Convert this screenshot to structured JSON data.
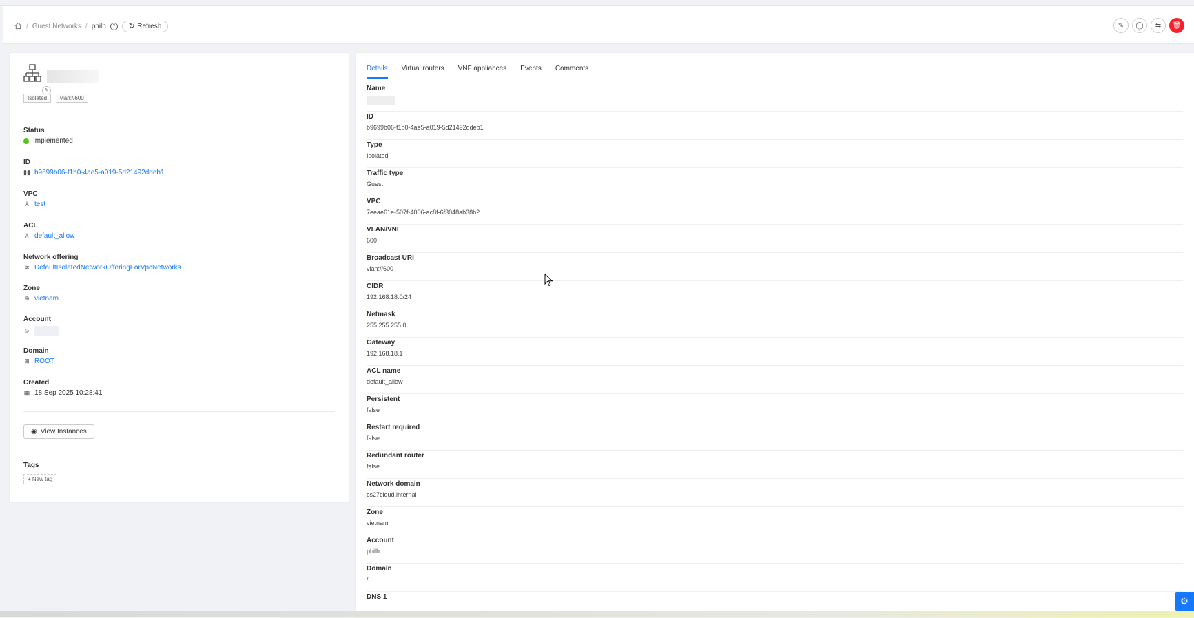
{
  "breadcrumb": {
    "section": "Guest Networks",
    "current": "philh",
    "refresh": "Refresh"
  },
  "header_actions": [
    {
      "icon": "edit-icon",
      "glyph": "✎"
    },
    {
      "icon": "restart-icon",
      "glyph": "◯"
    },
    {
      "icon": "swap-icon",
      "glyph": "⇆"
    },
    {
      "icon": "delete-icon",
      "glyph": "🗑"
    }
  ],
  "left": {
    "tags": [
      "Isolated",
      "vlan://600"
    ],
    "status": {
      "label": "Status",
      "value": "Implemented",
      "color": "#52c41a"
    },
    "id": {
      "label": "ID",
      "value": "b9699b06-f1b0-4ae5-a019-5d21492ddeb1"
    },
    "vpc": {
      "label": "VPC",
      "value": "test"
    },
    "acl": {
      "label": "ACL",
      "value": "default_allow"
    },
    "offering": {
      "label": "Network offering",
      "value": "DefaultIsolatedNetworkOfferingForVpcNetworks"
    },
    "zone": {
      "label": "Zone",
      "value": "vietnam"
    },
    "account": {
      "label": "Account"
    },
    "domain": {
      "label": "Domain",
      "value": "ROOT"
    },
    "created": {
      "label": "Created",
      "value": "18 Sep 2025 10:28:41"
    },
    "view_instances": "View Instances",
    "tags_label": "Tags",
    "new_tag": "+ New tag"
  },
  "tabs": [
    "Details",
    "Virtual routers",
    "VNF appliances",
    "Events",
    "Comments"
  ],
  "details": [
    {
      "k": "Name",
      "v": ""
    },
    {
      "k": "ID",
      "v": "b9699b06-f1b0-4ae5-a019-5d21492ddeb1"
    },
    {
      "k": "Type",
      "v": "Isolated"
    },
    {
      "k": "Traffic type",
      "v": "Guest"
    },
    {
      "k": "VPC",
      "v": "7eeae61e-507f-4006-ac8f-6f3048ab38b2"
    },
    {
      "k": "VLAN/VNI",
      "v": "600"
    },
    {
      "k": "Broadcast URI",
      "v": "vlan://600"
    },
    {
      "k": "CIDR",
      "v": "192.168.18.0/24"
    },
    {
      "k": "Netmask",
      "v": "255.255.255.0"
    },
    {
      "k": "Gateway",
      "v": "192.168.18.1"
    },
    {
      "k": "ACL name",
      "v": "default_allow"
    },
    {
      "k": "Persistent",
      "v": "false"
    },
    {
      "k": "Restart required",
      "v": "false"
    },
    {
      "k": "Redundant router",
      "v": "false"
    },
    {
      "k": "Network domain",
      "v": "cs27cloud.internal"
    },
    {
      "k": "Zone",
      "v": "vietnam"
    },
    {
      "k": "Account",
      "v": "philh"
    },
    {
      "k": "Domain",
      "v": "/"
    },
    {
      "k": "DNS 1",
      "v": ""
    }
  ]
}
